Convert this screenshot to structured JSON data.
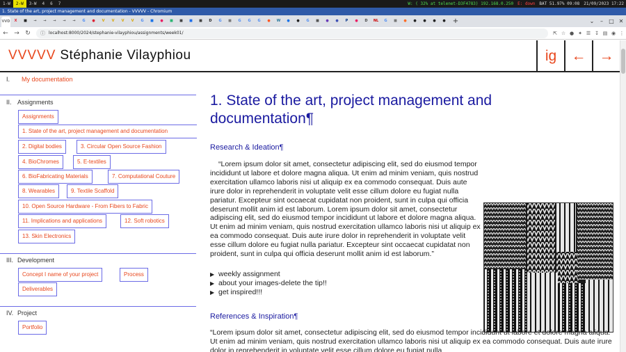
{
  "sysbar": {
    "workspaces": [
      "1-W",
      "2-W",
      "3-W",
      "4",
      "6",
      "7"
    ],
    "active_workspace": "2-W",
    "wifi": "W: ( 32% at telenet-D3F4783) 192.168.0.250",
    "ethernet": "E: down",
    "battery": "BAT 51.97% 09:08",
    "datetime": "21/09/2023  17:22"
  },
  "window": {
    "title": "1. State of the art, project management and documentation - VVVVV - Chromium"
  },
  "tabs": [
    {
      "label": "VVD",
      "color": "#777"
    },
    {
      "label": "X",
      "color": "#d23"
    },
    {
      "label": "■",
      "color": "#222"
    },
    {
      "label": "→",
      "color": "#555"
    },
    {
      "label": "→",
      "color": "#555"
    },
    {
      "label": "→",
      "color": "#555"
    },
    {
      "label": "→",
      "color": "#555"
    },
    {
      "label": "→",
      "color": "#555"
    },
    {
      "label": "G",
      "color": "#4285f4"
    },
    {
      "label": "●",
      "color": "#d23"
    },
    {
      "label": "V",
      "color": "#d9a400"
    },
    {
      "label": "V",
      "color": "#d9a400"
    },
    {
      "label": "V",
      "color": "#d9a400"
    },
    {
      "label": "V",
      "color": "#d9a400"
    },
    {
      "label": "G",
      "color": "#4285f4"
    },
    {
      "label": "■",
      "color": "#1a73e8"
    },
    {
      "label": "●",
      "color": "#e91e63"
    },
    {
      "label": "■",
      "color": "#2bb673"
    },
    {
      "label": "■",
      "color": "#444"
    },
    {
      "label": "■",
      "color": "#1f6feb"
    },
    {
      "label": "■",
      "color": "#444"
    },
    {
      "label": "D",
      "color": "#222"
    },
    {
      "label": "G",
      "color": "#4285f4"
    },
    {
      "label": "■",
      "color": "#7a7a7a"
    },
    {
      "label": "G",
      "color": "#4285f4"
    },
    {
      "label": "G",
      "color": "#4285f4"
    },
    {
      "label": "G",
      "color": "#4285f4"
    },
    {
      "label": "●",
      "color": "#ff5722"
    },
    {
      "label": "W",
      "color": "#21759b"
    },
    {
      "label": "●",
      "color": "#1a73e8"
    },
    {
      "label": "●",
      "color": "#222"
    },
    {
      "label": "G",
      "color": "#4285f4"
    },
    {
      "label": "■",
      "color": "#555"
    },
    {
      "label": "●",
      "color": "#673ab7"
    },
    {
      "label": "●",
      "color": "#3f51b5"
    },
    {
      "label": "P",
      "color": "#003087"
    },
    {
      "label": "●",
      "color": "#e91e63"
    },
    {
      "label": "D",
      "color": "#444"
    },
    {
      "label": "NL",
      "color": "#c00"
    },
    {
      "label": "G",
      "color": "#4285f4"
    },
    {
      "label": "■",
      "color": "#777"
    },
    {
      "label": "●",
      "color": "#fc6d26"
    },
    {
      "label": "●",
      "color": "#222"
    },
    {
      "label": "●",
      "color": "#222"
    },
    {
      "label": "●",
      "color": "#222"
    },
    {
      "label": "●",
      "color": "#222"
    }
  ],
  "active_tab_index": 0,
  "toolbar": {
    "url": "localhost:8000/2024/stephanie-vilayphiou/assignments/week01/",
    "back_icon": "←",
    "forward_icon": "→",
    "reload_icon": "↻",
    "info_icon": "ⓘ"
  },
  "site": {
    "brand": "VVVVV",
    "name": "Stéphanie Vilayphiou",
    "ig": "ig",
    "prev": "←",
    "next": "→",
    "accent": "#e8471d",
    "link": "#1a1aa0",
    "rule": "#6a6ae6"
  },
  "sidebar": {
    "sections": [
      {
        "num": "I.",
        "title": "My documentation",
        "orange": true
      },
      {
        "num": "II.",
        "title": "Assignments",
        "orange": false
      },
      {
        "num": "III.",
        "title": "Development",
        "orange": false
      },
      {
        "num": "IV.",
        "title": "Project",
        "orange": false
      }
    ],
    "assignments": [
      "Assignments",
      "1. State of the art, project management and documentation",
      "2. Digital bodies",
      "3. Circular Open Source Fashion",
      "4. BioChromes",
      "5. E-textiles",
      "6. BioFabricating Materials",
      "7. Computational Couture",
      "8. Wearables",
      "9. Textile Scaffold",
      "10. Open Source Hardware - From Fibers to Fabric",
      "11. Implications and applications",
      "12. Soft robotics",
      "13. Skin Electronics"
    ],
    "development": [
      "Concept I name of your project",
      "Process",
      "Deliverables"
    ],
    "project": [
      "Portfolio"
    ]
  },
  "main": {
    "title": "1. State of the art, project management and documentation",
    "pilcrow": "¶",
    "h_research": "Research & Ideation",
    "para1": "“Lorem ipsum dolor sit amet, consectetur adipiscing elit, sed do eiusmod tempor incididunt ut labore et dolore magna aliqua. Ut enim ad minim veniam, quis nostrud exercitation ullamco laboris nisi ut aliquip ex ea commodo consequat. Duis aute irure dolor in reprehenderit in voluptate velit esse cillum dolore eu fugiat nulla pariatur. Excepteur sint occaecat cupidatat non proident, sunt in culpa qui officia deserunt mollit anim id est laborum. Lorem ipsum dolor sit amet, consectetur adipiscing elit, sed do eiusmod tempor incididunt ut labore et dolore magna aliqua. Ut enim ad minim veniam, quis nostrud exercitation ullamco laboris nisi ut aliquip ex ea commodo consequat. Duis aute irure dolor in reprehenderit in voluptate velit esse cillum dolore eu fugiat nulla pariatur. Excepteur sint occaecat cupidatat non proident, sunt in culpa qui officia deserunt mollit anim id est laborum.”",
    "bullets": [
      "weekly assignment",
      "about your images-delete the tip!!",
      "get inspired!!!"
    ],
    "h_refs": "References & Inspiration",
    "para2": "“Lorem ipsum dolor sit amet, consectetur adipiscing elit, sed do eiusmod tempor incididunt ut labore et dolore magna aliqua. Ut enim ad minim veniam, quis nostrud exercitation ullamco laboris nisi ut aliquip ex ea commodo consequat. Duis aute irure dolor in reprehenderit in voluptate velit esse cillum dolore eu fugiat nulla"
  }
}
